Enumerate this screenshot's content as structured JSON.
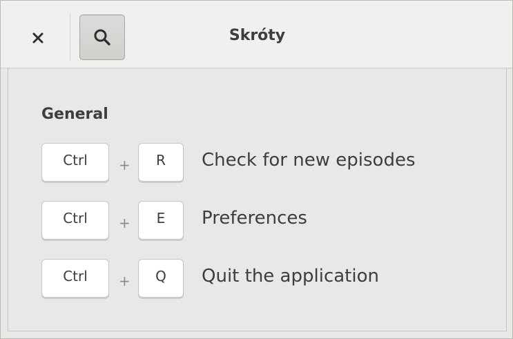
{
  "header": {
    "title": "Skróty",
    "close_icon": "close-icon",
    "search_icon": "search-icon"
  },
  "section": {
    "title": "General"
  },
  "shortcuts": [
    {
      "modifier": "Ctrl",
      "plus": "+",
      "key": "R",
      "description": "Check for new episodes"
    },
    {
      "modifier": "Ctrl",
      "plus": "+",
      "key": "E",
      "description": "Preferences"
    },
    {
      "modifier": "Ctrl",
      "plus": "+",
      "key": "Q",
      "description": "Quit the application"
    }
  ],
  "colors": {
    "text": "#3d3d3b",
    "background": "#e8e8e7",
    "header": "#f0f0ef",
    "key": "#ffffff"
  }
}
